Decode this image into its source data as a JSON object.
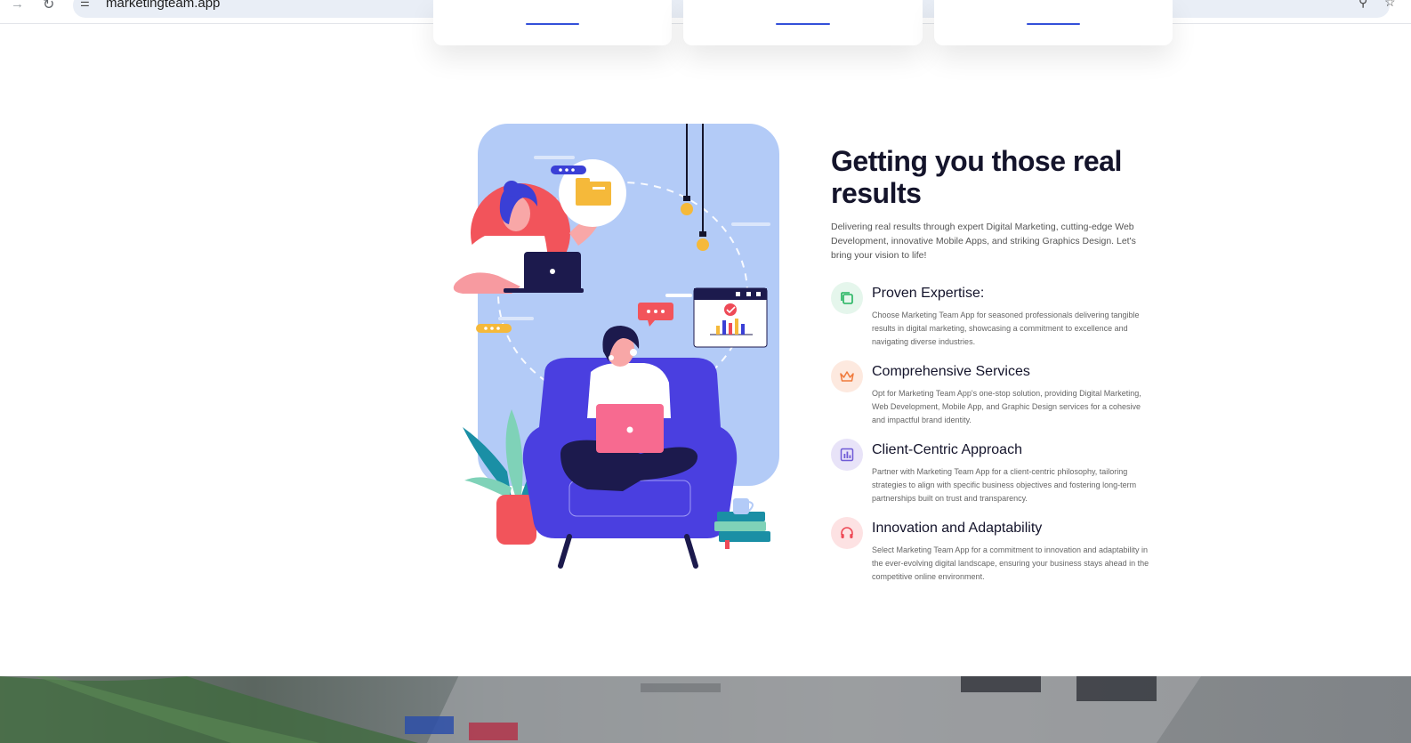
{
  "browser": {
    "url": "marketingteam.app"
  },
  "section": {
    "heading": "Getting you those real results",
    "intro": "Delivering real results through expert Digital Marketing, cutting-edge Web Development, innovative Mobile Apps, and striking Graphics Design. Let's bring your vision to life!"
  },
  "features": [
    {
      "icon": "copy-icon",
      "title": "Proven Expertise:",
      "description": "Choose Marketing Team App for seasoned professionals delivering tangible results in digital marketing, showcasing a commitment to excellence and navigating diverse industries.",
      "color": "#22b35e",
      "bg": "#e5f6ec"
    },
    {
      "icon": "crown-icon",
      "title": "Comprehensive Services",
      "description": "Opt for Marketing Team App's one-stop solution, providing Digital Marketing, Web Development, Mobile App, and Graphic Design services for a cohesive and impactful brand identity.",
      "color": "#f07a3c",
      "bg": "#fde9df"
    },
    {
      "icon": "chart-icon",
      "title": "Client-Centric Approach",
      "description": "Partner with Marketing Team App for a client-centric philosophy, tailoring strategies to align with specific business objectives and fostering long-term partnerships built on trust and transparency.",
      "color": "#6f5bd6",
      "bg": "#e8e3f8"
    },
    {
      "icon": "headphones-icon",
      "title": "Innovation and Adaptability",
      "description": "Select Marketing Team App for a commitment to innovation and adaptability in the ever-evolving digital landscape, ensuring your business stays ahead in the competitive online environment.",
      "color": "#ee4a57",
      "bg": "#fde2e3"
    }
  ]
}
